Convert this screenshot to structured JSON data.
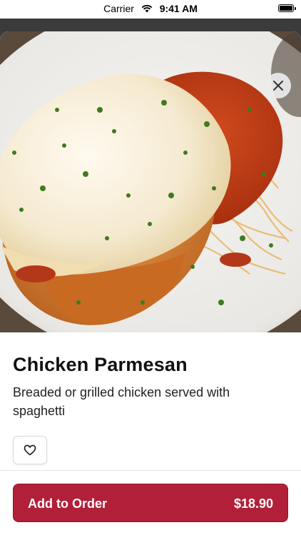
{
  "status_bar": {
    "carrier": "Carrier",
    "time": "9:41 AM",
    "wifi_icon": "wifi-icon",
    "battery_icon": "battery-icon"
  },
  "item": {
    "image_icon": "food-photo",
    "name": "Chicken Parmesan",
    "description": "Breaded or grilled chicken served with spaghetti"
  },
  "actions": {
    "close_icon": "close-icon",
    "favorite_icon": "heart-icon",
    "add_to_order_label": "Add to Order",
    "price": "$18.90"
  },
  "colors": {
    "accent": "#b21f38",
    "background": "#ffffff"
  }
}
